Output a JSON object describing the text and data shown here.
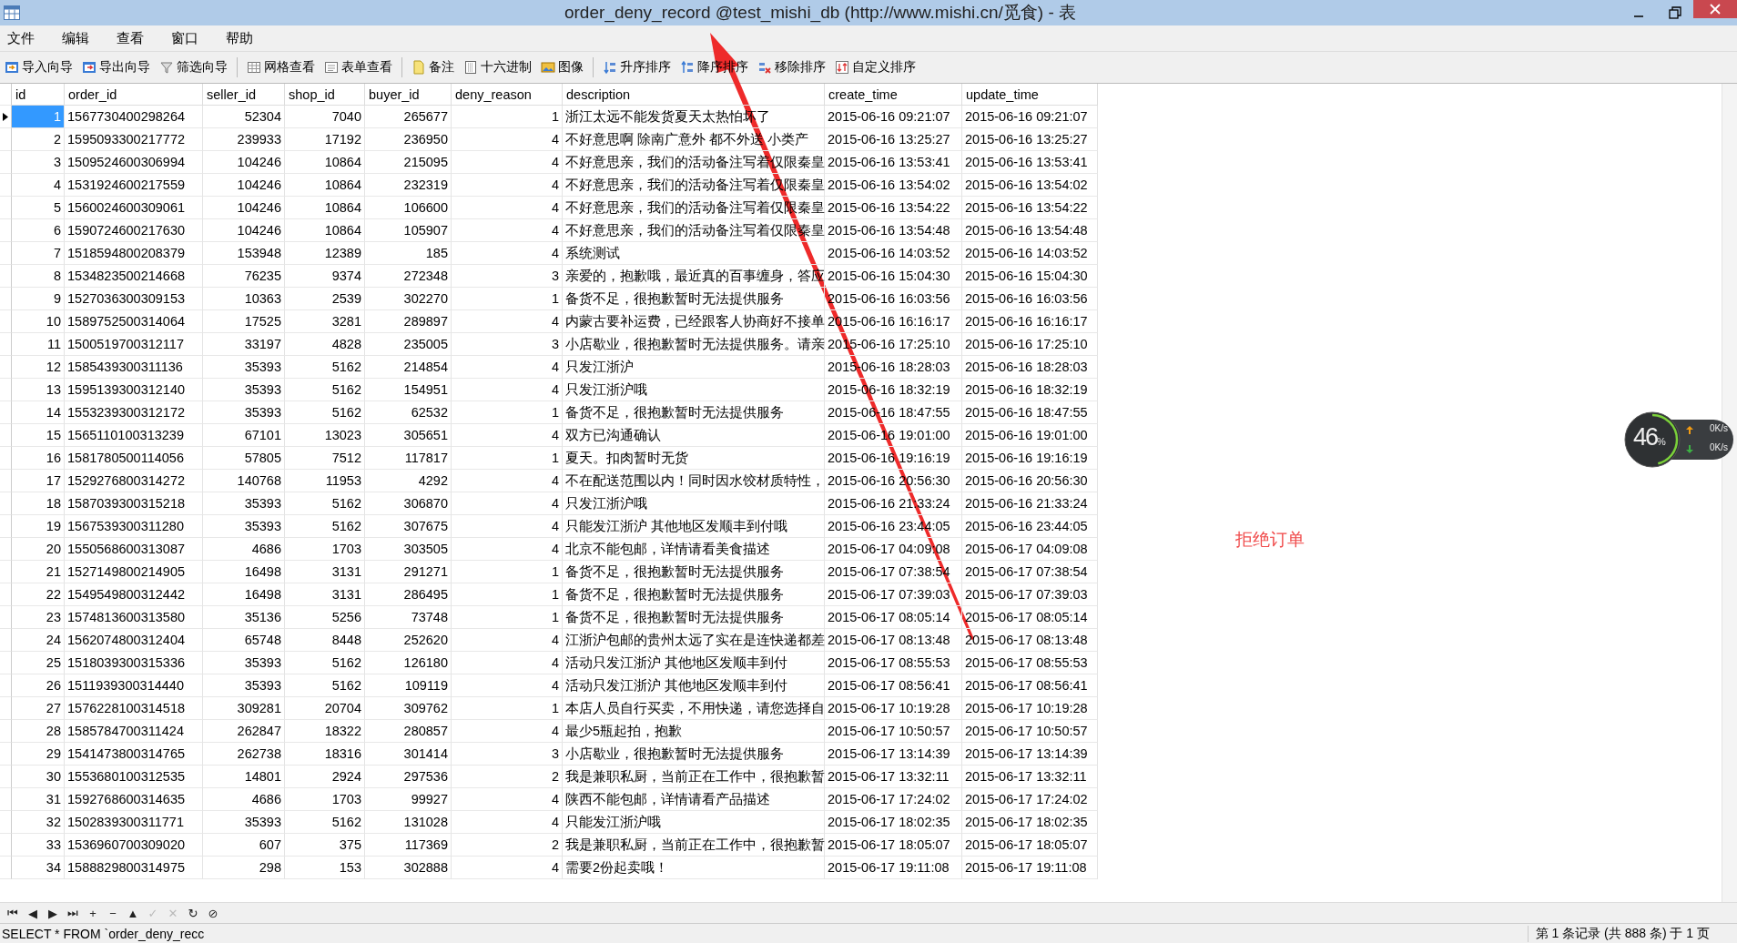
{
  "window": {
    "title": "order_deny_record @test_mishi_db (http://www.mishi.cn/觅食) - 表"
  },
  "menu": [
    "文件",
    "编辑",
    "查看",
    "窗口",
    "帮助"
  ],
  "toolbar": [
    {
      "kind": "import",
      "label": "导入向导"
    },
    {
      "kind": "export",
      "label": "导出向导"
    },
    {
      "kind": "filter",
      "label": "筛选向导"
    },
    {
      "kind": "sep"
    },
    {
      "kind": "grid",
      "label": "网格查看"
    },
    {
      "kind": "form",
      "label": "表单查看"
    },
    {
      "kind": "sep"
    },
    {
      "kind": "note",
      "label": "备注"
    },
    {
      "kind": "hex",
      "label": "十六进制"
    },
    {
      "kind": "image",
      "label": "图像"
    },
    {
      "kind": "sep"
    },
    {
      "kind": "sortasc",
      "label": "升序排序"
    },
    {
      "kind": "sortdesc",
      "label": "降序排序"
    },
    {
      "kind": "sortremove",
      "label": "移除排序"
    },
    {
      "kind": "sortcustom",
      "label": "自定义排序"
    }
  ],
  "table": {
    "columns": [
      "id",
      "order_id",
      "seller_id",
      "shop_id",
      "buyer_id",
      "deny_reason",
      "description",
      "create_time",
      "update_time"
    ],
    "rows": [
      {
        "selected": true,
        "cells": [
          "1",
          "1567730400298264",
          "52304",
          "7040",
          "265677",
          "1",
          "浙江太远不能发货夏天太热怕坏了",
          "2015-06-16 09:21:07",
          "2015-06-16 09:21:07"
        ]
      },
      {
        "selected": false,
        "cells": [
          "2",
          "1595093300217772",
          "239933",
          "17192",
          "236950",
          "4",
          "不好意思啊 除南广意外 都不外送 小类产",
          "2015-06-16 13:25:27",
          "2015-06-16 13:25:27"
        ]
      },
      {
        "selected": false,
        "cells": [
          "3",
          "1509524600306994",
          "104246",
          "10864",
          "215095",
          "4",
          "不好意思亲，我们的活动备注写着仅限秦皇",
          "2015-06-16 13:53:41",
          "2015-06-16 13:53:41"
        ]
      },
      {
        "selected": false,
        "cells": [
          "4",
          "1531924600217559",
          "104246",
          "10864",
          "232319",
          "4",
          "不好意思亲，我们的活动备注写着仅限秦皇",
          "2015-06-16 13:54:02",
          "2015-06-16 13:54:02"
        ]
      },
      {
        "selected": false,
        "cells": [
          "5",
          "1560024600309061",
          "104246",
          "10864",
          "106600",
          "4",
          "不好意思亲，我们的活动备注写着仅限秦皇",
          "2015-06-16 13:54:22",
          "2015-06-16 13:54:22"
        ]
      },
      {
        "selected": false,
        "cells": [
          "6",
          "1590724600217630",
          "104246",
          "10864",
          "105907",
          "4",
          "不好意思亲，我们的活动备注写着仅限秦皇",
          "2015-06-16 13:54:48",
          "2015-06-16 13:54:48"
        ]
      },
      {
        "selected": false,
        "cells": [
          "7",
          "1518594800208379",
          "153948",
          "12389",
          "185",
          "4",
          "系统测试",
          "2015-06-16 14:03:52",
          "2015-06-16 14:03:52"
        ]
      },
      {
        "selected": false,
        "cells": [
          "8",
          "1534823500214668",
          "76235",
          "9374",
          "272348",
          "3",
          "亲爱的，抱歉哦，最近真的百事缠身，答应",
          "2015-06-16 15:04:30",
          "2015-06-16 15:04:30"
        ]
      },
      {
        "selected": false,
        "cells": [
          "9",
          "1527036300309153",
          "10363",
          "2539",
          "302270",
          "1",
          "备货不足，很抱歉暂时无法提供服务",
          "2015-06-16 16:03:56",
          "2015-06-16 16:03:56"
        ]
      },
      {
        "selected": false,
        "cells": [
          "10",
          "1589752500314064",
          "17525",
          "3281",
          "289897",
          "4",
          "内蒙古要补运费，已经跟客人协商好不接单",
          "2015-06-16 16:16:17",
          "2015-06-16 16:16:17"
        ]
      },
      {
        "selected": false,
        "cells": [
          "11",
          "1500519700312117",
          "33197",
          "4828",
          "235005",
          "3",
          "小店歇业，很抱歉暂时无法提供服务。请亲",
          "2015-06-16 17:25:10",
          "2015-06-16 17:25:10"
        ]
      },
      {
        "selected": false,
        "cells": [
          "12",
          "1585439300311136",
          "35393",
          "5162",
          "214854",
          "4",
          "只发江浙沪",
          "2015-06-16 18:28:03",
          "2015-06-16 18:28:03"
        ]
      },
      {
        "selected": false,
        "cells": [
          "13",
          "1595139300312140",
          "35393",
          "5162",
          "154951",
          "4",
          "只发江浙沪哦",
          "2015-06-16 18:32:19",
          "2015-06-16 18:32:19"
        ]
      },
      {
        "selected": false,
        "cells": [
          "14",
          "1553239300312172",
          "35393",
          "5162",
          "62532",
          "1",
          "备货不足，很抱歉暂时无法提供服务",
          "2015-06-16 18:47:55",
          "2015-06-16 18:47:55"
        ]
      },
      {
        "selected": false,
        "cells": [
          "15",
          "1565110100313239",
          "67101",
          "13023",
          "305651",
          "4",
          "双方已沟通确认",
          "2015-06-16 19:01:00",
          "2015-06-16 19:01:00"
        ]
      },
      {
        "selected": false,
        "cells": [
          "16",
          "1581780500114056",
          "57805",
          "7512",
          "117817",
          "1",
          "夏天。扣肉暂时无货",
          "2015-06-16 19:16:19",
          "2015-06-16 19:16:19"
        ]
      },
      {
        "selected": false,
        "cells": [
          "17",
          "1529276800314272",
          "140768",
          "11953",
          "4292",
          "4",
          "不在配送范围以内！同时因水饺材质特性，",
          "2015-06-16 20:56:30",
          "2015-06-16 20:56:30"
        ]
      },
      {
        "selected": false,
        "cells": [
          "18",
          "1587039300315218",
          "35393",
          "5162",
          "306870",
          "4",
          "只发江浙沪哦",
          "2015-06-16 21:33:24",
          "2015-06-16 21:33:24"
        ]
      },
      {
        "selected": false,
        "cells": [
          "19",
          "1567539300311280",
          "35393",
          "5162",
          "307675",
          "4",
          "只能发江浙沪 其他地区发顺丰到付哦",
          "2015-06-16 23:44:05",
          "2015-06-16 23:44:05"
        ]
      },
      {
        "selected": false,
        "cells": [
          "20",
          "1550568600313087",
          "4686",
          "1703",
          "303505",
          "4",
          "北京不能包邮，详情请看美食描述",
          "2015-06-17 04:09:08",
          "2015-06-17 04:09:08"
        ]
      },
      {
        "selected": false,
        "cells": [
          "21",
          "1527149800214905",
          "16498",
          "3131",
          "291271",
          "1",
          "备货不足，很抱歉暂时无法提供服务",
          "2015-06-17 07:38:54",
          "2015-06-17 07:38:54"
        ]
      },
      {
        "selected": false,
        "cells": [
          "22",
          "1549549800312442",
          "16498",
          "3131",
          "286495",
          "1",
          "备货不足，很抱歉暂时无法提供服务",
          "2015-06-17 07:39:03",
          "2015-06-17 07:39:03"
        ]
      },
      {
        "selected": false,
        "cells": [
          "23",
          "1574813600313580",
          "35136",
          "5256",
          "73748",
          "1",
          "备货不足，很抱歉暂时无法提供服务",
          "2015-06-17 08:05:14",
          "2015-06-17 08:05:14"
        ]
      },
      {
        "selected": false,
        "cells": [
          "24",
          "1562074800312404",
          "65748",
          "8448",
          "252620",
          "4",
          "江浙沪包邮的贵州太远了实在是连快递都差",
          "2015-06-17 08:13:48",
          "2015-06-17 08:13:48"
        ]
      },
      {
        "selected": false,
        "cells": [
          "25",
          "1518039300315336",
          "35393",
          "5162",
          "126180",
          "4",
          "活动只发江浙沪 其他地区发顺丰到付",
          "2015-06-17 08:55:53",
          "2015-06-17 08:55:53"
        ]
      },
      {
        "selected": false,
        "cells": [
          "26",
          "1511939300314440",
          "35393",
          "5162",
          "109119",
          "4",
          "活动只发江浙沪 其他地区发顺丰到付",
          "2015-06-17 08:56:41",
          "2015-06-17 08:56:41"
        ]
      },
      {
        "selected": false,
        "cells": [
          "27",
          "1576228100314518",
          "309281",
          "20704",
          "309762",
          "1",
          "本店人员自行买卖，不用快递，请您选择自",
          "2015-06-17 10:19:28",
          "2015-06-17 10:19:28"
        ]
      },
      {
        "selected": false,
        "cells": [
          "28",
          "1585784700311424",
          "262847",
          "18322",
          "280857",
          "4",
          "最少5瓶起拍，抱歉",
          "2015-06-17 10:50:57",
          "2015-06-17 10:50:57"
        ]
      },
      {
        "selected": false,
        "cells": [
          "29",
          "1541473800314765",
          "262738",
          "18316",
          "301414",
          "3",
          "小店歇业，很抱歉暂时无法提供服务",
          "2015-06-17 13:14:39",
          "2015-06-17 13:14:39"
        ]
      },
      {
        "selected": false,
        "cells": [
          "30",
          "1553680100312535",
          "14801",
          "2924",
          "297536",
          "2",
          "我是兼职私厨，当前正在工作中，很抱歉暂",
          "2015-06-17 13:32:11",
          "2015-06-17 13:32:11"
        ]
      },
      {
        "selected": false,
        "cells": [
          "31",
          "1592768600314635",
          "4686",
          "1703",
          "99927",
          "4",
          "陕西不能包邮，详情请看产品描述",
          "2015-06-17 17:24:02",
          "2015-06-17 17:24:02"
        ]
      },
      {
        "selected": false,
        "cells": [
          "32",
          "1502839300311771",
          "35393",
          "5162",
          "131028",
          "4",
          "只能发江浙沪哦",
          "2015-06-17 18:02:35",
          "2015-06-17 18:02:35"
        ]
      },
      {
        "selected": false,
        "cells": [
          "33",
          "1536960700309020",
          "607",
          "375",
          "117369",
          "2",
          "我是兼职私厨，当前正在工作中，很抱歉暂",
          "2015-06-17 18:05:07",
          "2015-06-17 18:05:07"
        ]
      },
      {
        "selected": false,
        "cells": [
          "34",
          "1588829800314975",
          "298",
          "153",
          "302888",
          "4",
          "需要2份起卖哦！",
          "2015-06-17 19:11:08",
          "2015-06-17 19:11:08"
        ]
      }
    ]
  },
  "annotation": {
    "label": "拒绝订单"
  },
  "monitor": {
    "percent": "46",
    "unit": "%",
    "level": 0.46,
    "upload": "0K/s",
    "download": "0K/s"
  },
  "nav_buttons": [
    {
      "label": "⏮",
      "disabled": false
    },
    {
      "label": "◀",
      "disabled": false
    },
    {
      "label": "▶",
      "disabled": false
    },
    {
      "label": "⏭",
      "disabled": false
    },
    {
      "label": "+",
      "disabled": false
    },
    {
      "label": "−",
      "disabled": false
    },
    {
      "label": "▲",
      "disabled": false
    },
    {
      "label": "✓",
      "disabled": true
    },
    {
      "label": "✕",
      "disabled": true
    },
    {
      "label": "↻",
      "disabled": false
    },
    {
      "label": "⊘",
      "disabled": false
    }
  ],
  "status_bar": {
    "query": "SELECT * FROM `order_deny_recc",
    "records": "第 1 条记录 (共 888 条) 于 1 页"
  }
}
